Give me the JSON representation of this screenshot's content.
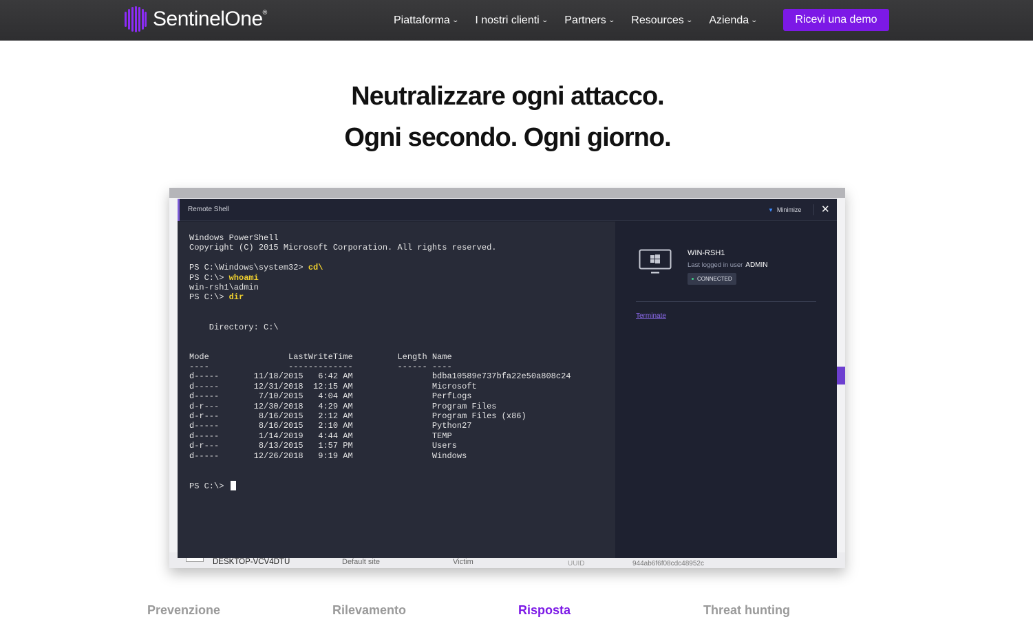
{
  "nav": {
    "logo_text_bold": "Sentinel",
    "logo_text_thin": "One",
    "logo_mark": "®",
    "items": [
      {
        "label": "Piattaforma"
      },
      {
        "label": "I nostri clienti"
      },
      {
        "label": "Partners"
      },
      {
        "label": "Resources"
      },
      {
        "label": "Azienda"
      }
    ],
    "demo_label": "Ricevi una demo",
    "chevron_icon": "chevron-down-icon"
  },
  "hero": {
    "line1": "Neutralizzare ogni attacco.",
    "line2": "Ogni secondo. Ogni giorno."
  },
  "background_app": {
    "row_device": "DESKTOP-VCV4DTU",
    "row_site": "Default site",
    "row_group": "Victim",
    "uuid_label": "UUID",
    "uuid_value": "944ab6f6f08cdc48952c"
  },
  "remote_shell": {
    "title": "Remote Shell",
    "minimize_label": "Minimize",
    "close_icon": "close-icon",
    "terminal_lines": [
      {
        "text": "Windows PowerShell",
        "cmd": ""
      },
      {
        "text": "Copyright (C) 2015 Microsoft Corporation. All rights reserved.",
        "cmd": ""
      },
      {
        "text": "",
        "cmd": ""
      },
      {
        "text": "PS C:\\Windows\\system32> ",
        "cmd": "cd\\"
      },
      {
        "text": "PS C:\\> ",
        "cmd": "whoami"
      },
      {
        "text": "win-rsh1\\admin",
        "cmd": ""
      },
      {
        "text": "PS C:\\> ",
        "cmd": "dir"
      },
      {
        "text": "",
        "cmd": ""
      },
      {
        "text": "",
        "cmd": ""
      },
      {
        "text": "    Directory: C:\\",
        "cmd": ""
      },
      {
        "text": "",
        "cmd": ""
      },
      {
        "text": "",
        "cmd": ""
      },
      {
        "text": "Mode                LastWriteTime         Length Name",
        "cmd": ""
      },
      {
        "text": "----                -------------         ------ ----",
        "cmd": ""
      },
      {
        "text": "d-----       11/18/2015   6:42 AM                bdba10589e737bfa22e50a808c24",
        "cmd": ""
      },
      {
        "text": "d-----       12/31/2018  12:15 AM                Microsoft",
        "cmd": ""
      },
      {
        "text": "d-----        7/10/2015   4:04 AM                PerfLogs",
        "cmd": ""
      },
      {
        "text": "d-r---       12/30/2018   4:29 AM                Program Files",
        "cmd": ""
      },
      {
        "text": "d-r---        8/16/2015   2:12 AM                Program Files (x86)",
        "cmd": ""
      },
      {
        "text": "d-----        8/16/2015   2:10 AM                Python27",
        "cmd": ""
      },
      {
        "text": "d-----        1/14/2019   4:44 AM                TEMP",
        "cmd": ""
      },
      {
        "text": "d-r---        8/13/2015   1:57 PM                Users",
        "cmd": ""
      },
      {
        "text": "d-----       12/26/2018   9:19 AM                Windows",
        "cmd": ""
      },
      {
        "text": "",
        "cmd": ""
      },
      {
        "text": "",
        "cmd": ""
      },
      {
        "text": "PS C:\\> ",
        "cmd": "",
        "cursor": true
      }
    ],
    "host": {
      "name": "WIN-RSH1",
      "last_logged_label": "Last logged in user",
      "last_logged_user": "ADMIN",
      "status": "CONNECTED",
      "status_color": "#3ed08a",
      "icon": "windows-monitor-icon"
    },
    "terminate_label": "Terminate"
  },
  "tabs": [
    {
      "label": "Prevenzione",
      "active": false
    },
    {
      "label": "Rilevamento",
      "active": false
    },
    {
      "label": "Risposta",
      "active": true
    },
    {
      "label": "Threat hunting",
      "active": false
    }
  ],
  "colors": {
    "brand_purple": "#7c19e6",
    "nav_bg": "#333335",
    "terminal_bg": "#282b38",
    "command_yellow": "#f2d22e"
  }
}
